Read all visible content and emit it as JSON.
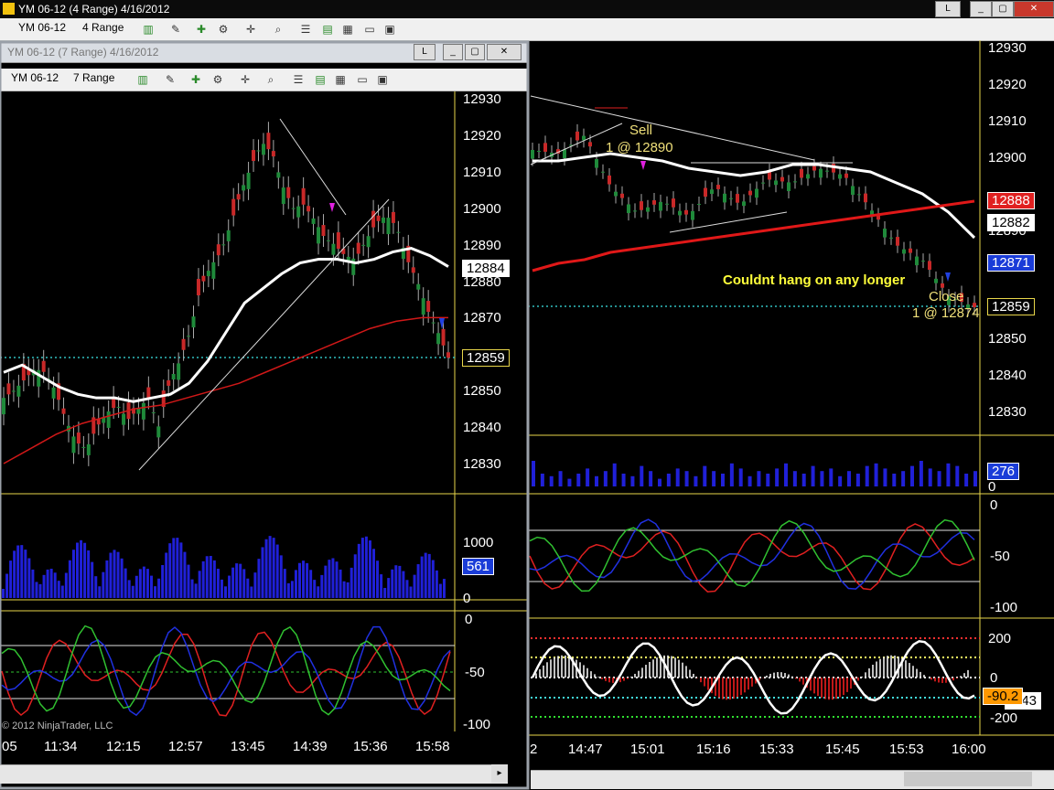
{
  "main_window": {
    "title": "YM 06-12 (4 Range)  4/16/2012",
    "toolbar": {
      "instrument": "YM 06-12",
      "period": "4 Range"
    },
    "buttons": {
      "link": "L"
    }
  },
  "sub_window": {
    "title": "YM 06-12 (7 Range)  4/16/2012",
    "toolbar": {
      "instrument": "YM 06-12",
      "period": "7 Range"
    },
    "buttons": {
      "link": "L"
    },
    "copyright": "© 2012 NinjaTrader, LLC"
  },
  "chart_data": [
    {
      "type": "line",
      "title": "YM 06-12 (4 Range)",
      "panel": "price",
      "y_ticks": [
        "12930",
        "12920",
        "12910",
        "12900",
        "12890",
        "12880",
        "12870",
        "12860",
        "12850",
        "12840",
        "12830"
      ],
      "x_ticks": [
        "2",
        "14:47",
        "15:01",
        "15:16",
        "15:33",
        "15:45",
        "15:53",
        "16:00"
      ],
      "price_badges": [
        {
          "label": "12888",
          "color": "#e02020"
        },
        {
          "label": "12882",
          "color": "#ffffff"
        },
        {
          "label": "12871",
          "color": "#1a3cd8"
        },
        {
          "label": "12859",
          "color": "#000000"
        }
      ],
      "annotations": [
        {
          "text": "Sell"
        },
        {
          "text": "1 @ 12890"
        },
        {
          "text": "Couldnt hang on any longer"
        },
        {
          "text": "Close"
        },
        {
          "text": "1 @ 12874"
        }
      ],
      "series": [
        {
          "name": "ma_white",
          "color": "#ffffff",
          "values": [
            12899,
            12899,
            12900,
            12901,
            12900,
            12899,
            12897,
            12896,
            12895,
            12896,
            12898,
            12898,
            12897,
            12896,
            12893,
            12890,
            12885,
            12878
          ]
        },
        {
          "name": "ma_red",
          "color": "#e01818",
          "values": [
            12869,
            12871,
            12872,
            12874,
            12875,
            12876,
            12877,
            12878,
            12879,
            12880,
            12881,
            12882,
            12883,
            12884,
            12885,
            12886,
            12887,
            12888
          ]
        }
      ],
      "close": [
        12902,
        12901,
        12906,
        12892,
        12885,
        12888,
        12884,
        12892,
        12887,
        12894,
        12893,
        12897,
        12895,
        12886,
        12876,
        12872,
        12862,
        12859
      ],
      "ylim": [
        12822,
        12935
      ]
    },
    {
      "type": "bar",
      "panel": "volume_right",
      "y_ticks": [
        "0"
      ],
      "badge": "276",
      "values": [
        1,
        0.5,
        0.4,
        0.6,
        0.3,
        0.5,
        0.7,
        0.4,
        0.6,
        0.9,
        0.5,
        0.4,
        0.8,
        0.6,
        0.3,
        0.5,
        0.7,
        0.6,
        0.4,
        0.8,
        0.6,
        0.5,
        0.9,
        0.7,
        0.4,
        0.6,
        0.5,
        0.7,
        0.9,
        0.6,
        0.5,
        0.8,
        0.6,
        0.7,
        0.4,
        0.6,
        0.5,
        0.8,
        0.9,
        0.7,
        0.5,
        0.6,
        0.8,
        1,
        0.7,
        0.6,
        0.9,
        0.8,
        0.5,
        0.6
      ]
    },
    {
      "type": "line",
      "panel": "stoch_right",
      "y_ticks": [
        "0",
        "-50",
        "-100"
      ]
    },
    {
      "type": "bar",
      "panel": "cci_right",
      "y_ticks": [
        "200",
        "0",
        "-200"
      ],
      "badges": [
        {
          "label": "-90.2",
          "color": "#ff9800"
        },
        {
          "label": "-143",
          "color": "#ffffff"
        }
      ]
    },
    {
      "type": "line",
      "title": "YM 06-12 (7 Range)",
      "panel": "price_left",
      "y_ticks": [
        "12930",
        "12920",
        "12910",
        "12900",
        "12890",
        "12880",
        "12870",
        "12860",
        "12850",
        "12840",
        "12830"
      ],
      "x_ticks": [
        "05",
        "11:34",
        "12:15",
        "12:57",
        "13:45",
        "14:39",
        "15:36",
        "15:58"
      ],
      "price_badges": [
        {
          "label": "12884",
          "color": "#ffffff"
        },
        {
          "label": "12859",
          "color": "#000000"
        }
      ],
      "close": [
        12848,
        12850,
        12853,
        12856,
        12855,
        12850,
        12842,
        12836,
        12834,
        12840,
        12844,
        12846,
        12842,
        12845,
        12848,
        12840,
        12852,
        12858,
        12866,
        12878,
        12884,
        12888,
        12896,
        12905,
        12912,
        12918,
        12915,
        12906,
        12900,
        12901,
        12897,
        12892,
        12890,
        12887,
        12886,
        12891,
        12896,
        12898,
        12895,
        12886,
        12880,
        12872,
        12866,
        12859
      ],
      "ylim": [
        12822,
        12935
      ]
    },
    {
      "type": "bar",
      "panel": "volume_left",
      "y_ticks": [
        "1000",
        "0"
      ],
      "badge": "561"
    },
    {
      "type": "line",
      "panel": "stoch_left",
      "y_ticks": [
        "0",
        "-50",
        "-100"
      ]
    }
  ],
  "colors": {
    "price_up": "#1f8a3a",
    "price_down": "#c82828",
    "axis": "#e8e8e8",
    "volume": "#2020d8",
    "sep": "#f0e050"
  }
}
